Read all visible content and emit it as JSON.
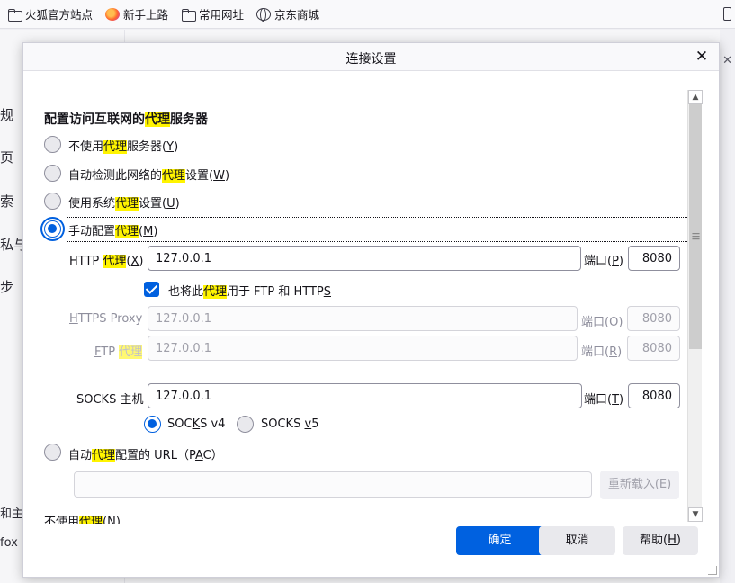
{
  "bookmarks": [
    {
      "icon": "folder-icon",
      "label": "火狐官方站点"
    },
    {
      "icon": "firefox-icon",
      "label": "新手上路"
    },
    {
      "icon": "folder-icon",
      "label": "常用网址"
    },
    {
      "icon": "globe-icon",
      "label": "京东商城"
    }
  ],
  "background": {
    "side_labels": [
      "规",
      "页",
      "索",
      "私与",
      "步",
      "和主",
      "fox"
    ]
  },
  "dialog": {
    "title": "连接设置",
    "close_symbol": "✕",
    "section_title": {
      "pre": "配置访问互联网的",
      "hl": "代理",
      "post": "服务器"
    },
    "options": {
      "no_proxy": {
        "pre": "不使用",
        "hl": "代理",
        "mid": "服务器(",
        "key": "Y",
        "post": ")"
      },
      "auto_detect": {
        "pre": "自动检测此网络的",
        "hl": "代理",
        "mid": "设置(",
        "key": "W",
        "post": ")"
      },
      "system": {
        "pre": "使用系统",
        "hl": "代理",
        "mid": "设置(",
        "key": "U",
        "post": ")"
      },
      "manual": {
        "pre": "手动配置",
        "hl": "代理",
        "mid": "(",
        "key": "M",
        "post": ")"
      },
      "pac": {
        "pre": "自动",
        "hl": "代理",
        "mid": "配置的 URL（P",
        "key": "A",
        "post": "C）"
      }
    },
    "http": {
      "pre": "HTTP ",
      "hl": "代理",
      "mid": "(",
      "key": "X",
      "post": ")",
      "value": "127.0.0.1",
      "port_label": {
        "pre": "端口(",
        "key": "P",
        "post": ")"
      },
      "port": "8080"
    },
    "also_use": {
      "pre": "也将此",
      "hl": "代理",
      "mid": "用于 FTP 和 HTTP",
      "key": "S",
      "post": ""
    },
    "https": {
      "key": "H",
      "post": "TTPS Proxy",
      "value": "127.0.0.1",
      "port_label": {
        "pre": "端口(",
        "key": "O",
        "post": ")"
      },
      "port": "8080"
    },
    "ftp": {
      "key": "F",
      "mid": "TP ",
      "hl": "代理",
      "value": "127.0.0.1",
      "port_label": {
        "pre": "端口(",
        "key": "R",
        "post": ")"
      },
      "port": "8080"
    },
    "socks": {
      "label": "SOCKS 主机",
      "value": "127.0.0.1",
      "port_label": {
        "pre": "端口(",
        "key": "T",
        "post": ")"
      },
      "port": "8080"
    },
    "socks_v4": {
      "pre": "SOC",
      "key": "K",
      "post": "S v4"
    },
    "socks_v5": {
      "pre": "SOCKS ",
      "key": "v",
      "post": "5"
    },
    "pac_url": "",
    "reload": {
      "pre": "重新载入(",
      "key": "E",
      "post": ")"
    },
    "no_proxy_for": {
      "pre": "不使用",
      "hl": "代理",
      "mid": "(",
      "key": "N",
      "post": ")"
    },
    "buttons": {
      "ok": "确定",
      "cancel": "取消",
      "help": {
        "pre": "帮助(",
        "key": "H",
        "post": ")"
      }
    }
  },
  "state": {
    "selected_mode": "manual",
    "also_use_checked": true,
    "socks_version": "v4"
  }
}
